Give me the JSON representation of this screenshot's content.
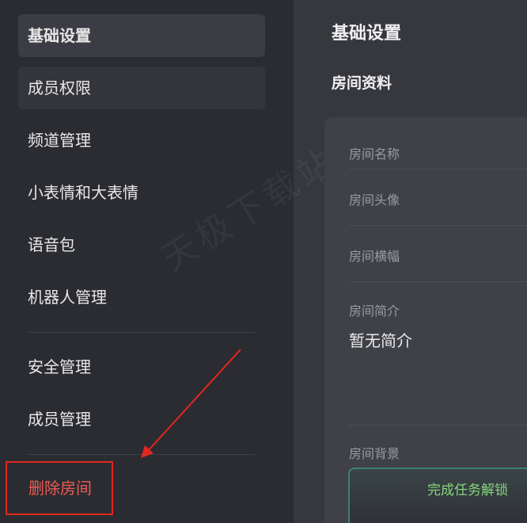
{
  "sidebar": {
    "items": [
      {
        "label": "基础设置"
      },
      {
        "label": "成员权限"
      },
      {
        "label": "频道管理"
      },
      {
        "label": "小表情和大表情"
      },
      {
        "label": "语音包"
      },
      {
        "label": "机器人管理"
      },
      {
        "label": "安全管理"
      },
      {
        "label": "成员管理"
      }
    ],
    "delete_label": "删除房间"
  },
  "main": {
    "title": "基础设置",
    "section_title": "房间资料",
    "fields": {
      "name_label": "房间名称",
      "avatar_label": "房间头像",
      "banner_label": "房间横幅",
      "intro_label": "房间简介",
      "intro_value": "暂无简介",
      "background_label": "房间背景"
    },
    "unlock_label": "完成任务解锁"
  },
  "watermark": "天极下载站",
  "colors": {
    "sidebar_bg": "#2b2c31",
    "main_bg": "#36383e",
    "danger": "#ef5a52",
    "highlight_box": "#e3261f",
    "unlock_text": "#86d67c"
  }
}
